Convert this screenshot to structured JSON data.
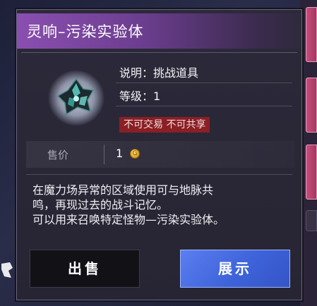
{
  "item": {
    "title": "灵响–污染实验体",
    "description_line": "说明：挑战道具",
    "level_line": "等级：1",
    "tag": "不可交易 不可共享",
    "icon": "cursed-crystal-icon"
  },
  "price": {
    "label": "售价",
    "value": "1",
    "currency_icon": "gold-coin-icon"
  },
  "description": {
    "lines": [
      "在魔力场异常的区域使用可与地脉共",
      "鸣，再现过去的战斗记忆。",
      "可以用来召唤特定怪物—污染实验体。"
    ]
  },
  "buttons": {
    "sell": "出售",
    "show": "展示"
  },
  "colors": {
    "title_bar": "#8a4fb0",
    "tag_bg": "#8a1f25",
    "show_button": "#4a6ee6",
    "sell_button": "#121116"
  }
}
